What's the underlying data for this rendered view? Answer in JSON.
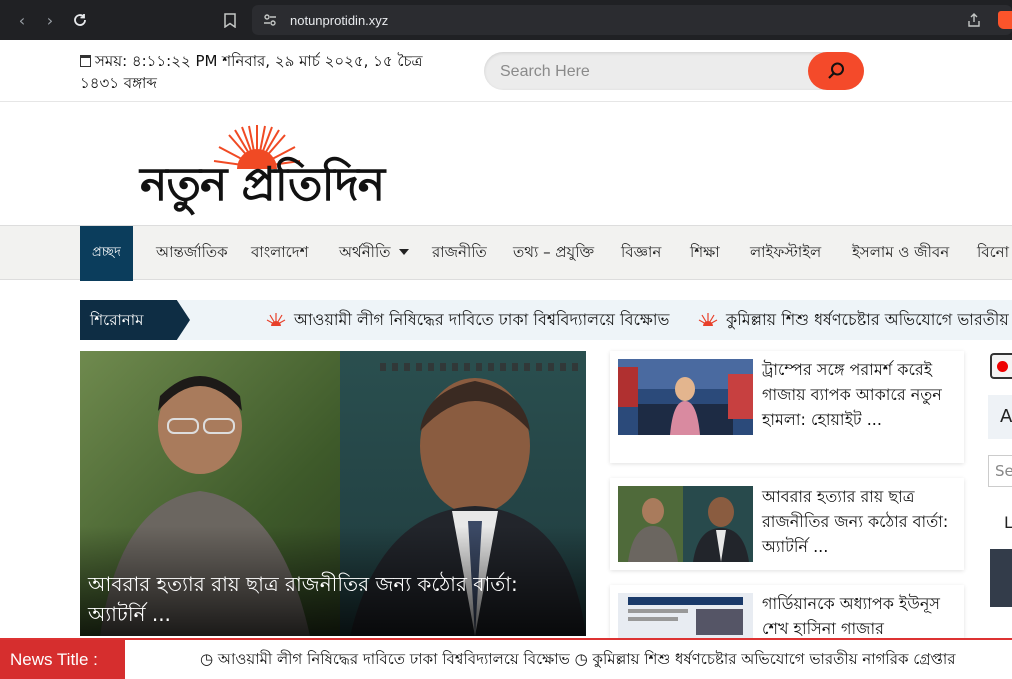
{
  "browser": {
    "url": "notunprotidin.xyz"
  },
  "header": {
    "datetime_line1": "সময়: ৪:১১:২২ PM শনিবার, ২৯ মার্চ ২০২৫, ১৫ চৈত্র",
    "datetime_line2": "১৪৩১ বঙ্গাব্দ",
    "search_placeholder": "Search Here"
  },
  "logo": {
    "text": "নতুন প্রতিদিন"
  },
  "nav": {
    "items": [
      "প্রচ্ছদ",
      "আন্তর্জাতিক",
      "বাংলাদেশ",
      "অর্থনীতি",
      "রাজনীতি",
      "তথ্য – প্রযুক্তি",
      "বিজ্ঞান",
      "শিক্ষা",
      "লাইফস্টাইল",
      "ইসলাম ও জীবন",
      "বিনো"
    ]
  },
  "ticker": {
    "label": "শিরোনাম",
    "items": [
      "আওয়ামী লীগ নিষিদ্ধের দাবিতে ঢাকা বিশ্ববিদ্যালয়ে বিক্ষোভ",
      "কুমিল্লায় শিশু ধর্ষণচেষ্টার অভিযোগে ভারতীয়"
    ]
  },
  "hero": {
    "title": "আবরার হত্যার রায় ছাত্র রাজনীতির জন্য কঠোর বার্তা: অ্যাটর্নি ..."
  },
  "side_news": [
    {
      "title": "ট্রাম্পের সঙ্গে পরামর্শ করেই গাজায় ব্যাপক আকারে নতুন হামলা: হোয়াইট ..."
    },
    {
      "title": "আবরার হত্যার রায় ছাত্র রাজনীতির জন্য কঠোর বার্তা: অ্যাটর্নি ..."
    },
    {
      "title": "গার্ডিয়ানকে অধ্যাপক ইউনূস শেখ হাসিনা গাজার"
    }
  ],
  "rail": {
    "letter_a": "A",
    "search_stub": "Se",
    "letter_l": "L"
  },
  "newsbar": {
    "label": "News Title :",
    "text": "◷ আওয়ামী লীগ নিষিদ্ধের দাবিতে ঢাকা বিশ্ববিদ্যালয়ে বিক্ষোভ ◷ কুমিল্লায় শিশু ধর্ষণচেষ্টার অভিযোগে ভারতীয় নাগরিক গ্রেপ্তার"
  },
  "colors": {
    "accent": "#f44a2a",
    "nav_active": "#0b3d5c",
    "ticker_label": "#0e2d44",
    "newsbar_red": "#d62e2e"
  }
}
